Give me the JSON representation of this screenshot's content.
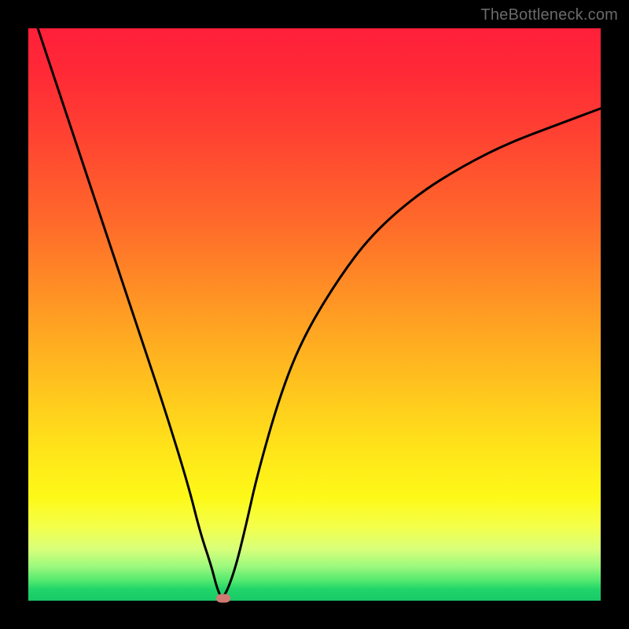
{
  "attribution": "TheBottleneck.com",
  "chart_data": {
    "type": "line",
    "title": "",
    "xlabel": "",
    "ylabel": "",
    "xlim": [
      0,
      100
    ],
    "ylim": [
      0,
      100
    ],
    "grid": false,
    "legend": false,
    "series": [
      {
        "name": "bottleneck-curve",
        "x": [
          0,
          4,
          8,
          12,
          16,
          20,
          24,
          28,
          30,
          32,
          33,
          34,
          36,
          38,
          40,
          44,
          48,
          54,
          60,
          68,
          76,
          84,
          92,
          100
        ],
        "y": [
          105,
          93,
          81,
          69,
          57,
          45,
          33,
          20,
          12,
          6,
          2,
          0,
          5,
          13,
          22,
          36,
          46,
          56,
          64,
          71,
          76,
          80,
          83,
          86
        ]
      }
    ],
    "annotations": [
      {
        "name": "minimum-marker",
        "x": 34,
        "y": 0,
        "color": "#cf7a72"
      }
    ],
    "background_gradient": {
      "top": "#ff1f3a",
      "middle": "#ffe51a",
      "bottom": "#18c866"
    }
  },
  "colors": {
    "frame": "#000000",
    "curve": "#000000",
    "marker": "#cf7a72",
    "gradient_top": "#ff1f3a",
    "gradient_bottom": "#18c866",
    "attribution_text": "#6a6a6a"
  }
}
